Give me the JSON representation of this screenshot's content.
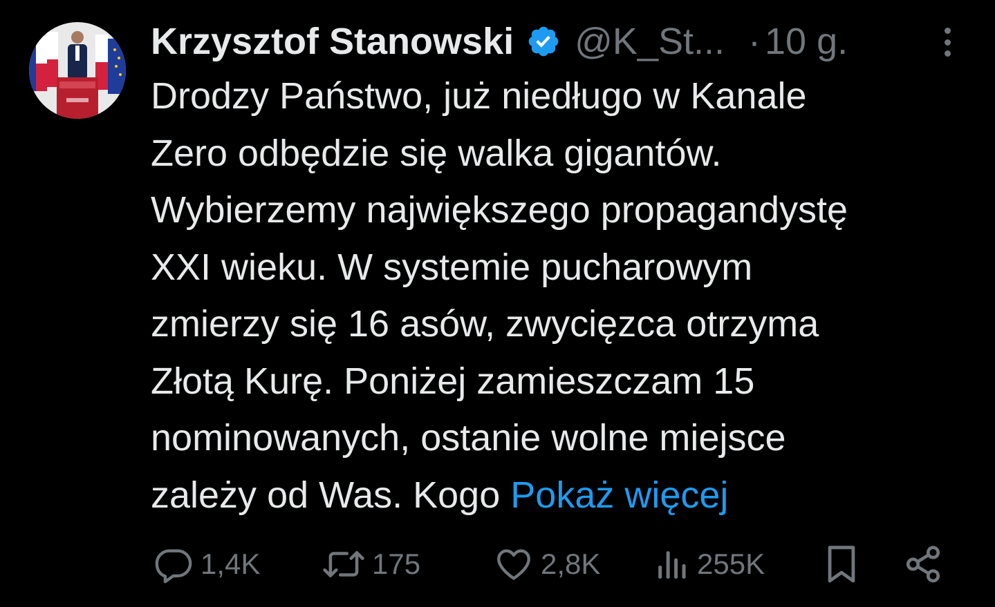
{
  "author": {
    "name": "Krzysztof Stanowski",
    "handle": "@K_St...",
    "separator": "·",
    "time": "10 g."
  },
  "tweet": {
    "text": "Drodzy Państwo, już niedługo w Kanale\nZero odbędzie się walka gigantów.\nWybierzemy największego propagandystę\nXXI wieku. W systemie pucharowym\nzmierzy się 16 asów, zwycięzca otrzyma\nZłotą Kurę. Poniżej zamieszczam 15\nnominowanych, ostanie wolne miejsce\nzależy od Was. Kogo ",
    "show_more": "Pokaż więcej"
  },
  "actions": {
    "replies": "1,4K",
    "reposts": "175",
    "likes": "2,8K",
    "views": "255K"
  },
  "icons": {
    "verified": "verified-badge-icon",
    "more": "more-icon",
    "reply": "reply-icon",
    "repost": "repost-icon",
    "like": "like-icon",
    "views": "views-icon",
    "bookmark": "bookmark-icon",
    "share": "share-icon"
  },
  "colors": {
    "background": "#000000",
    "text": "#e7e9ea",
    "muted": "#71767b",
    "accent": "#1d9bf0"
  }
}
